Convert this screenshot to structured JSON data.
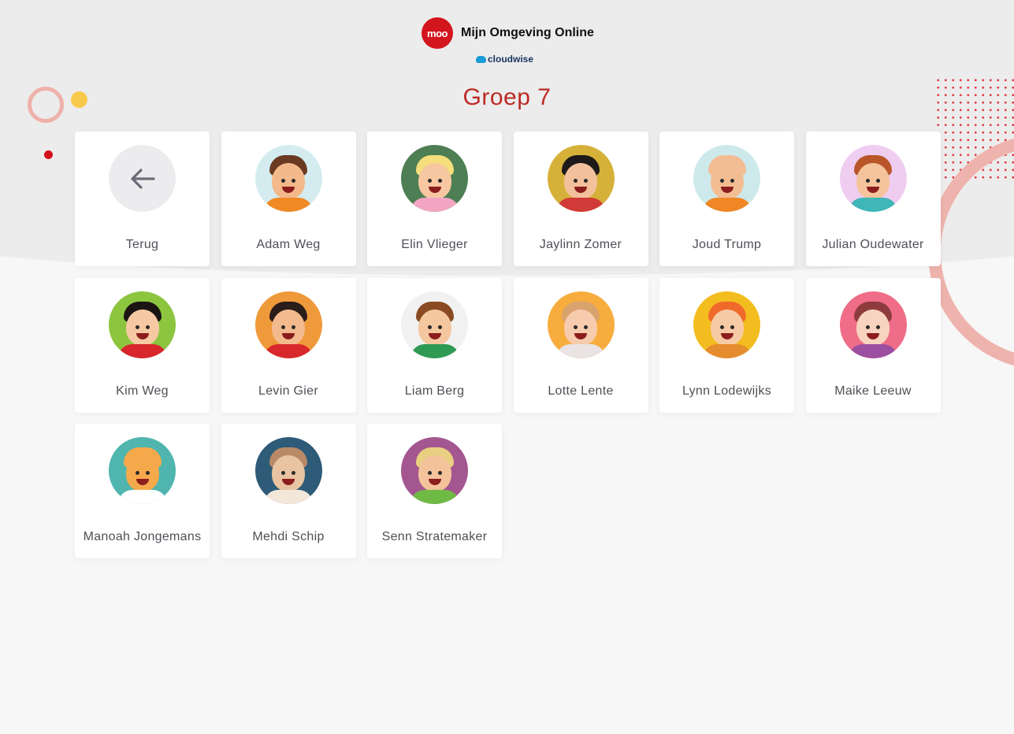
{
  "header": {
    "logo_text": "moo",
    "app_name": "Mijn Omgeving Online",
    "partner": "cloudwise"
  },
  "title": "Groep 7",
  "back_tile": {
    "label": "Terug",
    "icon": "arrow-left-icon"
  },
  "students": [
    {
      "name": "Adam Weg",
      "bg": "#d4ecf0",
      "skin": "#f3b98a",
      "hair": "#6a3a22",
      "shirt": "#f08a24"
    },
    {
      "name": "Elin Vlieger",
      "bg": "#4e7e54",
      "skin": "#f7c7a1",
      "hair": "#f6de7c",
      "shirt": "#f2a5c3"
    },
    {
      "name": "Jaylinn Zomer",
      "bg": "#d6b13a",
      "skin": "#f2c19c",
      "hair": "#1e1a1a",
      "shirt": "#d23a37"
    },
    {
      "name": "Joud Trump",
      "bg": "#cde9ec",
      "skin": "#f3bd94",
      "hair": "#f3bd94",
      "shirt": "#f08724"
    },
    {
      "name": "Julian Oudewater",
      "bg": "#efcdf0",
      "skin": "#f5c39c",
      "hair": "#b8562a",
      "shirt": "#3fb6b8"
    },
    {
      "name": "Kim Weg",
      "bg": "#8cc63f",
      "skin": "#f6c9a3",
      "hair": "#1b1413",
      "shirt": "#d8262c"
    },
    {
      "name": "Levin Gier",
      "bg": "#ef9a3a",
      "skin": "#f3ba8e",
      "hair": "#2a1d1a",
      "shirt": "#d8282c"
    },
    {
      "name": "Liam Berg",
      "bg": "#f1f1f1",
      "skin": "#f4c79f",
      "hair": "#8a4b22",
      "shirt": "#2f9a53"
    },
    {
      "name": "Lotte Lente",
      "bg": "#f6ad3e",
      "skin": "#f7cbad",
      "hair": "#d9a36e",
      "shirt": "#e9e3e3"
    },
    {
      "name": "Lynn Lodewijks",
      "bg": "#f3bd1f",
      "skin": "#f7caa6",
      "hair": "#ef6a2a",
      "shirt": "#e58c2e"
    },
    {
      "name": "Maike Leeuw",
      "bg": "#ef6d88",
      "skin": "#f8d3bf",
      "hair": "#8e3b3e",
      "shirt": "#9c4fa0"
    },
    {
      "name": "Manoah Jongemans",
      "bg": "#4fb5ae",
      "skin": "#f6a94a",
      "hair": "#f6a94a",
      "shirt": "#ffffff"
    },
    {
      "name": "Mehdi Schip",
      "bg": "#2d5b78",
      "skin": "#e8c4a2",
      "hair": "#b98a66",
      "shirt": "#f3e7da"
    },
    {
      "name": "Senn Stratemaker",
      "bg": "#a3568f",
      "skin": "#f4c39c",
      "hair": "#e9cf82",
      "shirt": "#6fba45"
    }
  ]
}
